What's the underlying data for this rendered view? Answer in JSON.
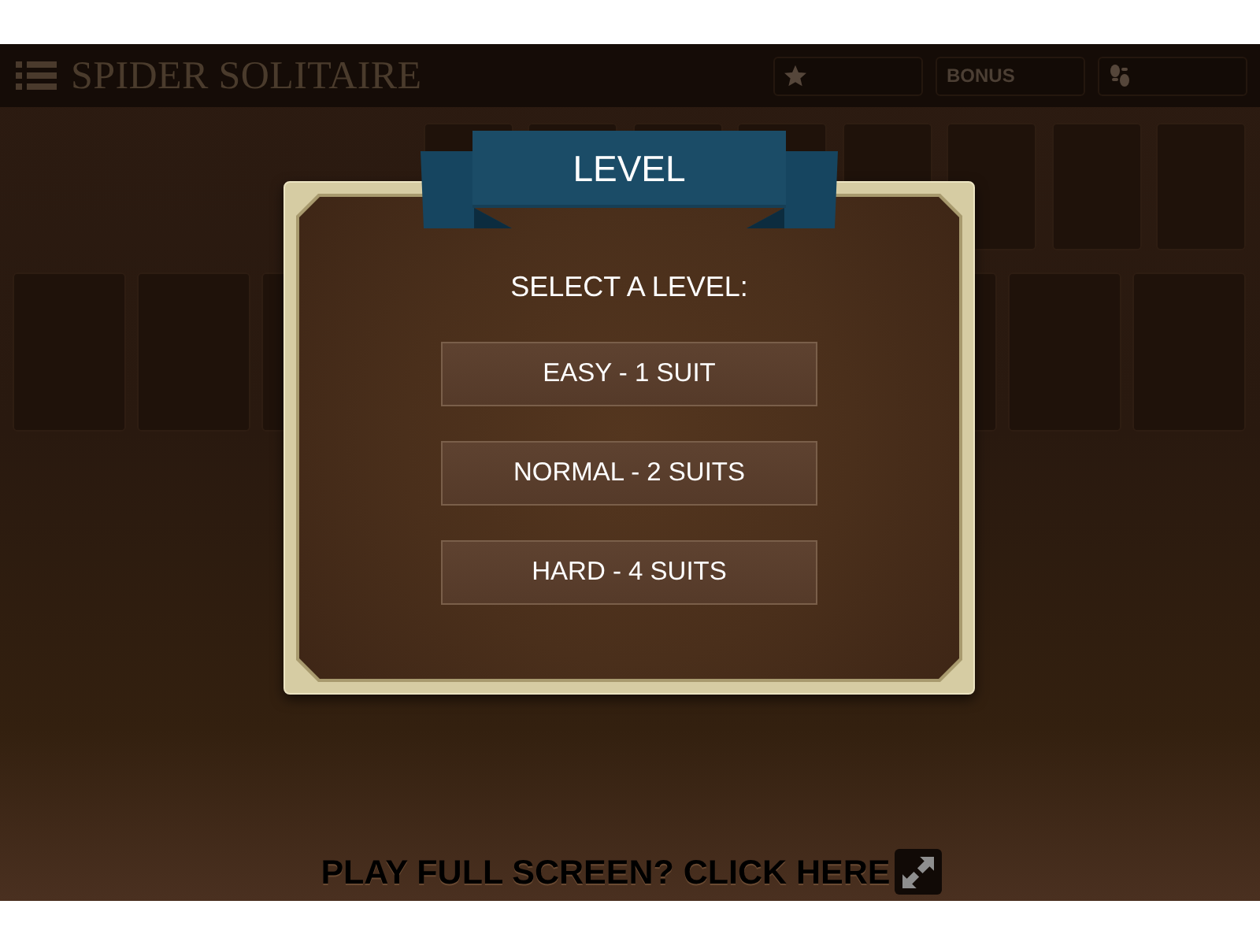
{
  "header": {
    "title": "SPIDER SOLITAIRE",
    "stats": [
      {
        "kind": "star"
      },
      {
        "kind": "label",
        "label": "BONUS"
      },
      {
        "kind": "footprints"
      }
    ]
  },
  "dialog": {
    "title": "LEVEL",
    "prompt": "SELECT A LEVEL:",
    "options": [
      {
        "label": "EASY - 1 SUIT"
      },
      {
        "label": "NORMAL - 2 SUITS"
      },
      {
        "label": "HARD - 4 SUITS"
      }
    ]
  },
  "footer": {
    "fullscreen_link": "PLAY FULL SCREEN? CLICK HERE"
  }
}
